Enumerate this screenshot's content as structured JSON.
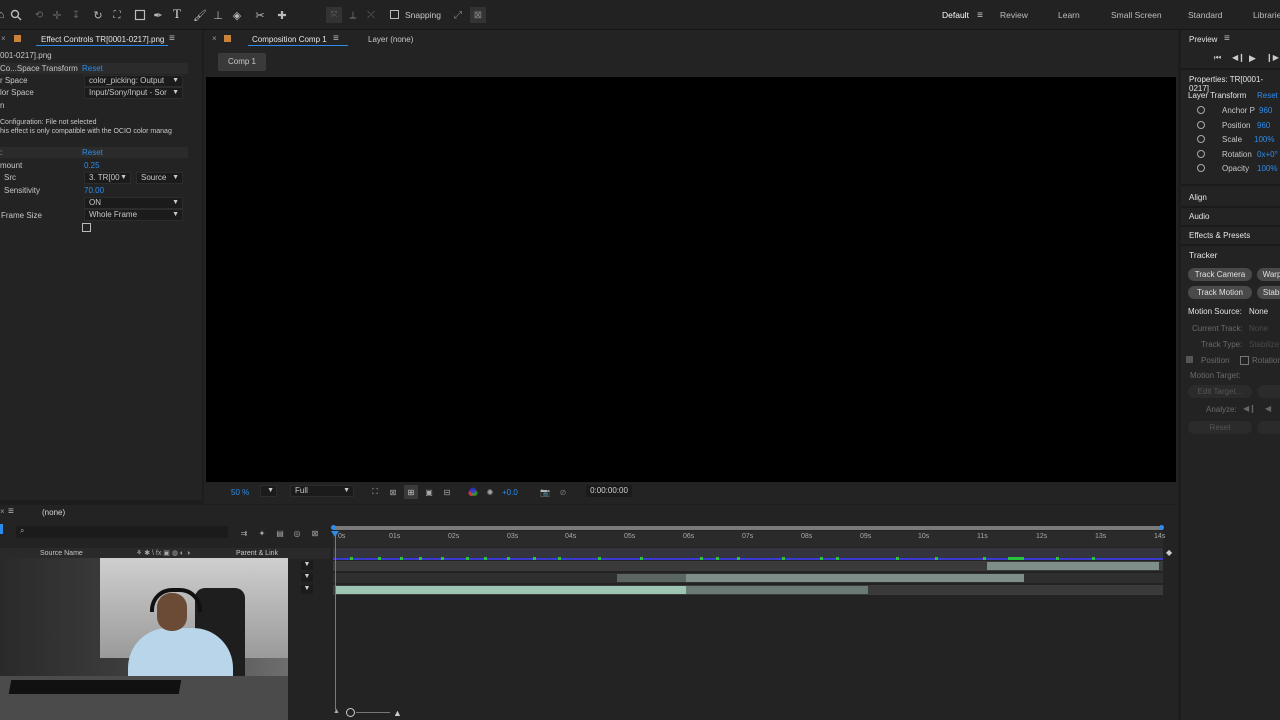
{
  "toolbar": {
    "snapping_label": "Snapping",
    "workspaces": [
      "Default",
      "Review",
      "Learn",
      "Small Screen",
      "Standard",
      "Librarie"
    ]
  },
  "effect_controls": {
    "tab_label": "Effect Controls TR[0001-0217].png",
    "file_label": "001-0217].png",
    "effect_name": "Co...Space Transform",
    "reset_label": "Reset",
    "rows": [
      {
        "label": "r Space",
        "value": "color_picking: Output"
      },
      {
        "label": "lor Space",
        "value": "Input/Sony/Input - Sor"
      },
      {
        "label": "n",
        "value": ""
      }
    ],
    "config_line1": "Configuration: File not selected",
    "config_line2": "his effect is only compatible with the OCIO color manag",
    "effect2_name": "",
    "effect2_reset": "Reset",
    "amount_label": "mount",
    "amount_value": "0.25",
    "src_label": "Src",
    "src_value": "3. TR[00",
    "src_source": "Source",
    "sens_label": "Sensitivity",
    "sens_value": "70.00",
    "on_value": "ON",
    "frame_label": "Frame Size",
    "frame_value": "Whole Frame"
  },
  "composition": {
    "tab_label": "Composition Comp 1",
    "layer_label": "Layer (none)",
    "breadcrumb": "Comp 1",
    "zoom": "50 %",
    "resolution": "Full",
    "exposure": "+0.0",
    "timecode": "0:00:00:00"
  },
  "timeline": {
    "comp_name": "(none)",
    "search_placeholder": "",
    "col_source": "Source Name",
    "col_parent": "Parent & Link",
    "ticks": [
      "0s",
      "01s",
      "02s",
      "03s",
      "04s",
      "05s",
      "06s",
      "07s",
      "08s",
      "09s",
      "10s",
      "11s",
      "12s",
      "13s",
      "14s"
    ]
  },
  "right_panel": {
    "preview_label": "Preview",
    "properties_label": "Properties: TR[0001-0217]",
    "layer_transform": "Layer Transform",
    "reset": "Reset",
    "props": [
      {
        "label": "Anchor P",
        "value": "960"
      },
      {
        "label": "Position",
        "value": "960"
      },
      {
        "label": "Scale",
        "value": "100%"
      },
      {
        "label": "Rotation",
        "value": "0x+0°"
      },
      {
        "label": "Opacity",
        "value": "100%"
      }
    ],
    "align": "Align",
    "audio": "Audio",
    "effects_presets": "Effects & Presets",
    "tracker": "Tracker",
    "track_camera": "Track Camera",
    "warp": "Warp",
    "track_motion": "Track Motion",
    "stabi": "Stabi",
    "motion_source_label": "Motion Source:",
    "motion_source_value": "None",
    "current_track_label": "Current Track:",
    "current_track_value": "None",
    "track_type_label": "Track Type:",
    "track_type_value": "Stabilize",
    "position_label": "Position",
    "rotation_label": "Rotation",
    "motion_target": "Motion Target:",
    "edit_target": "Edit Target...",
    "analyze": "Analyze:",
    "reset_btn": "Reset"
  },
  "colors": {
    "accent": "#2d8ceb",
    "bg": "#1d1d1d",
    "viewer": "#000000",
    "bar_green": "#8eb8a8",
    "bar_gray": "#6a7a74"
  }
}
